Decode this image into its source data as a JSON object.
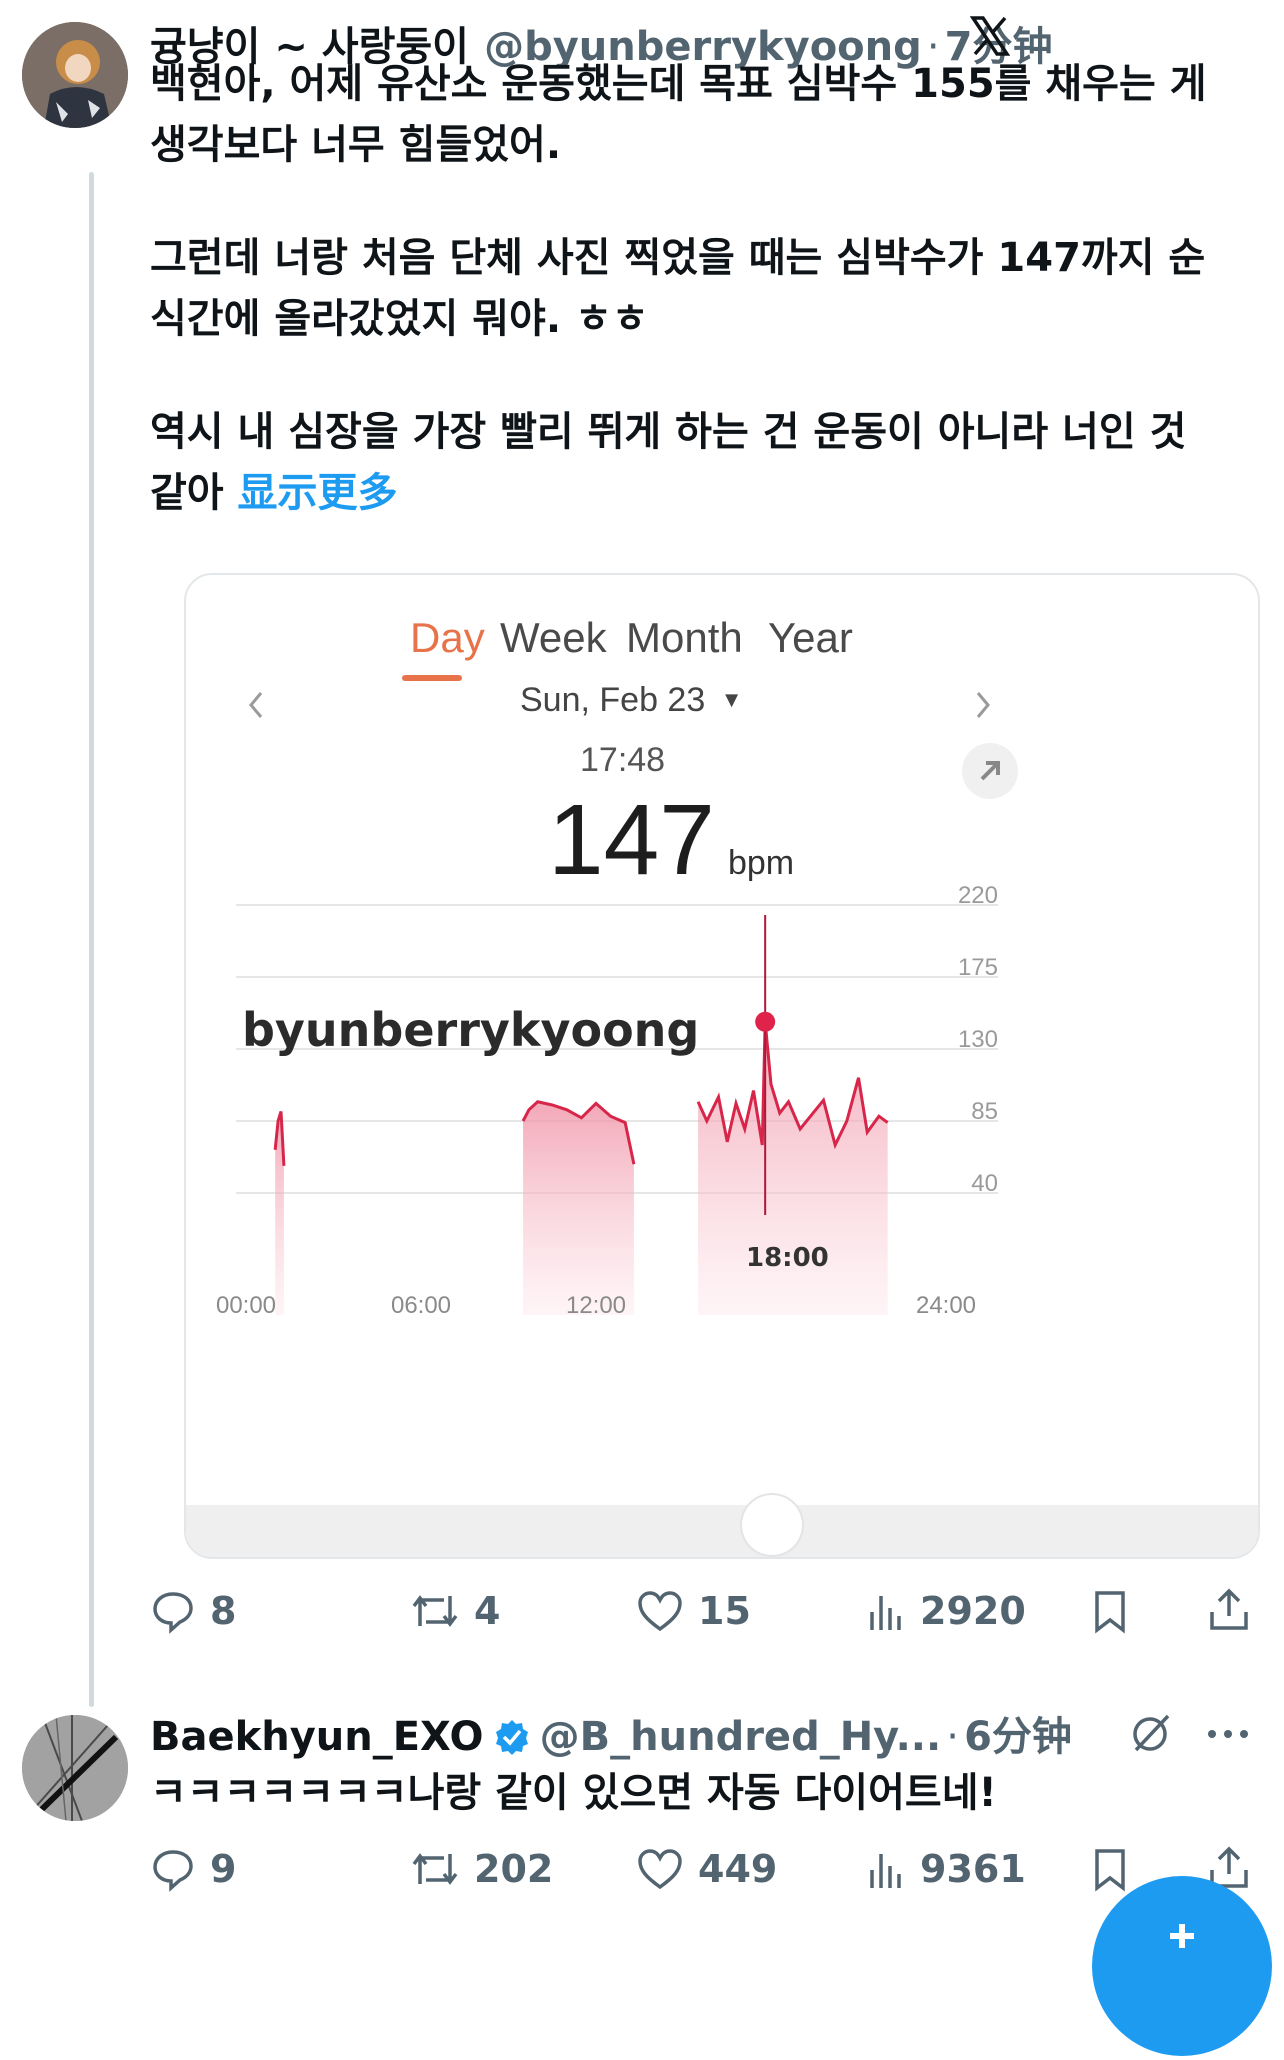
{
  "tweet1": {
    "display_name": "귱냥이 ~ 사랑둥이",
    "handle": "@byunberrykyoong",
    "time": "7分钟",
    "lines": [
      "백현아, 어제 유산소 운동했는데 목표 심박수 155를 채우는 게",
      "생각보다 너무 힘들었어.",
      "그런데 너랑 처음 단체 사진 찍었을 때는 심박수가 147까지 순",
      "식간에 올라갔었지 뭐야. ㅎㅎ",
      "역시 내 심장을 가장 빨리 뛰게 하는 건 운동이 아니라 너인 것",
      "같아"
    ],
    "show_more": "显示更多",
    "stats": {
      "replies": "8",
      "retweets": "4",
      "likes": "15",
      "views": "2920"
    }
  },
  "card": {
    "tabs": [
      "Day",
      "Week",
      "Month",
      "Year"
    ],
    "date": "Sun, Feb 23",
    "time": "17:48",
    "bpm": "147",
    "bpm_unit": "bpm",
    "watermark": "byunberrykyoong",
    "callout_time": "18:00"
  },
  "chart_data": {
    "type": "area",
    "y_ticks": [
      "220",
      "175",
      "130",
      "85",
      "40"
    ],
    "x_ticks": [
      "00:00",
      "06:00",
      "12:00",
      "24:00"
    ],
    "ylim": [
      40,
      220
    ],
    "xlim": [
      0,
      24
    ],
    "highlight": {
      "x": 17.8,
      "y": 147
    },
    "series": [
      {
        "values": [
          [
            1.0,
            67
          ],
          [
            1.1,
            85
          ],
          [
            1.2,
            91
          ],
          [
            1.3,
            57
          ]
        ]
      },
      {
        "values": [
          [
            9.5,
            85
          ],
          [
            9.7,
            92
          ],
          [
            10.0,
            97
          ],
          [
            10.5,
            95
          ],
          [
            11.0,
            92
          ],
          [
            11.5,
            87
          ],
          [
            12.0,
            96
          ],
          [
            12.5,
            88
          ],
          [
            13.0,
            84
          ],
          [
            13.3,
            58
          ]
        ]
      },
      {
        "values": [
          [
            15.5,
            97
          ],
          [
            15.8,
            85
          ],
          [
            16.2,
            100
          ],
          [
            16.5,
            72
          ],
          [
            16.8,
            96
          ],
          [
            17.1,
            80
          ],
          [
            17.4,
            104
          ],
          [
            17.7,
            70
          ],
          [
            17.8,
            147
          ],
          [
            18.0,
            108
          ],
          [
            18.3,
            90
          ],
          [
            18.6,
            97
          ],
          [
            19.0,
            80
          ],
          [
            19.4,
            89
          ],
          [
            19.8,
            98
          ],
          [
            20.2,
            70
          ],
          [
            20.6,
            85
          ],
          [
            21.0,
            112
          ],
          [
            21.3,
            78
          ],
          [
            21.7,
            88
          ],
          [
            22.0,
            84
          ]
        ]
      }
    ]
  },
  "tweet2": {
    "display_name": "Baekhyun_EXO",
    "handle": "@B_hundred_Hy...",
    "time": "6分钟",
    "text": "ㅋㅋㅋㅋㅋㅋㅋ나랑 같이 있으면 자동 다이어트네!",
    "stats": {
      "replies": "9",
      "retweets": "202",
      "likes": "449",
      "views": "9361"
    }
  },
  "colors": {
    "accent": "#1d9bf0",
    "tab_active": "#e8734a",
    "heart_line": "#d7264a",
    "heart_fill": "#f8c7d1"
  },
  "icons": [
    "x-logo-icon",
    "reply-icon",
    "retweet-icon",
    "like-icon",
    "views-icon",
    "bookmark-icon",
    "share-icon",
    "verified-badge-icon",
    "grok-icon",
    "more-icon",
    "compose-icon",
    "chevron-left-icon",
    "chevron-right-icon",
    "dropdown-arrow-icon",
    "expand-icon"
  ]
}
